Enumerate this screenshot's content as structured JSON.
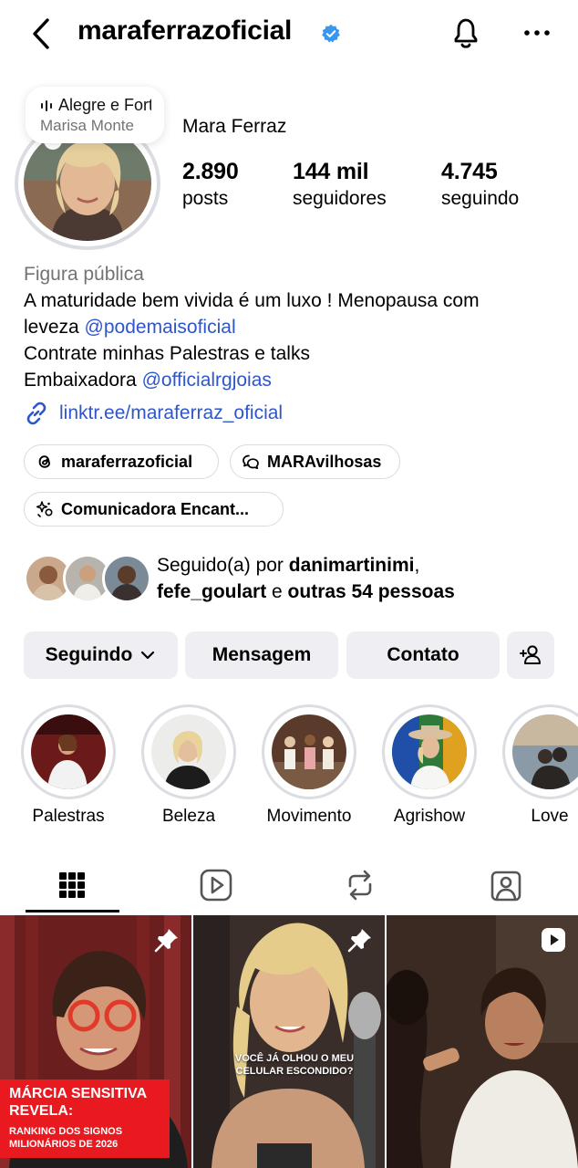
{
  "header": {
    "username": "maraferrazoficial",
    "verified": true,
    "icons": [
      "back-arrow-icon",
      "verified-badge-icon",
      "bell-icon",
      "more-options-icon"
    ]
  },
  "music": {
    "title": "Alegre e Forte",
    "artist": "Marisa Monte"
  },
  "profile": {
    "display_name": "Mara Ferraz",
    "stats": [
      {
        "value": "2.890",
        "label": "posts"
      },
      {
        "value": "144 mil",
        "label": "seguidores"
      },
      {
        "value": "4.745",
        "label": "seguindo"
      }
    ]
  },
  "bio": {
    "category": "Figura pública",
    "line1": "A maturidade bem vivida é um luxo ! Menopausa com",
    "line2_text": "leveza ",
    "line2_mention": "@podemaisoficial",
    "line3": "Contrate minhas Palestras e talks",
    "line4_text": "Embaixadora ",
    "line4_mention": "@officialrgjoias",
    "link": "linktr.ee/maraferraz_oficial"
  },
  "chips": {
    "threads": "maraferrazoficial",
    "channel": "MARAvilhosas",
    "community": "Comunicadora Encant..."
  },
  "followed_by": {
    "prefix": "Seguido(a) por ",
    "user1": "danimartinimi",
    "sep": ",",
    "user2": "fefe_goulart",
    "middle": " e ",
    "others": "outras 54 pessoas"
  },
  "actions": {
    "following": "Seguindo",
    "message": "Mensagem",
    "contact": "Contato"
  },
  "highlights": [
    {
      "label": "Palestras"
    },
    {
      "label": "Beleza"
    },
    {
      "label": "Movimento"
    },
    {
      "label": "Agrishow"
    },
    {
      "label": "Love"
    }
  ],
  "tabs": [
    "grid-icon",
    "reels-icon",
    "reposts-icon",
    "tagged-icon"
  ],
  "posts": [
    {
      "pinned": true,
      "overlay_title": "MÁRCIA SENSITIVA REVELA:",
      "overlay_sub": "RANKING DOS SIGNOS MILIONÁRIOS DE 2026"
    },
    {
      "pinned": true,
      "caption": "VOCÊ JÁ OLHOU O MEU CELULAR ESCONDIDO?"
    },
    {
      "reel": true
    }
  ],
  "colors": {
    "link": "#2f56c9",
    "verified": "#3897f0",
    "button_bg": "#efeff3",
    "secondary_text": "#737373",
    "overlay_red": "#e8191f"
  }
}
